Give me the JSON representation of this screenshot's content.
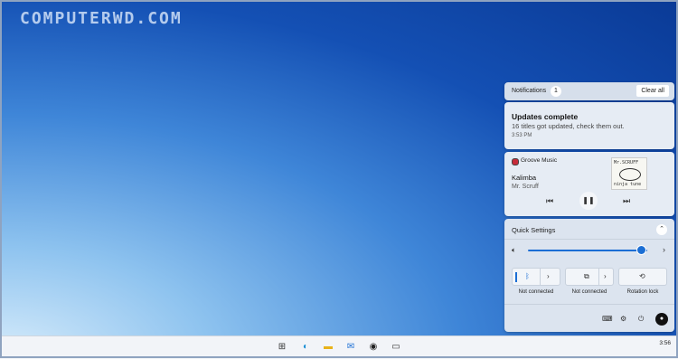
{
  "watermark": "COMPUTERWD.COM",
  "notifications": {
    "header_title": "Notifications",
    "count": "1",
    "clear_all": "Clear all",
    "items": [
      {
        "title": "Updates complete",
        "body": "16 titles got updated, check them out.",
        "time": "3:53 PM"
      }
    ]
  },
  "media": {
    "app": "Groove Music",
    "song": "Kalimba",
    "artist": "Mr. Scruff",
    "art_line1": "Mr.SCRUFF",
    "art_line2": "ninja tune",
    "prev_icon": "previous-track-icon",
    "pause_icon": "pause-icon",
    "next_icon": "next-track-icon"
  },
  "quick_settings": {
    "title": "Quick Settings",
    "volume_level": 0.95,
    "tiles": [
      {
        "label": "Not connected",
        "icon": "bluetooth-icon"
      },
      {
        "label": "Not connected",
        "icon": "cast-icon"
      },
      {
        "label": "Rotation lock",
        "icon": "rotation-lock-icon"
      }
    ],
    "footer_icons": [
      "keyboard-icon",
      "settings-icon",
      "power-icon",
      "account-icon"
    ]
  },
  "taskbar": {
    "time": "3:56",
    "icons": [
      "windows-start-icon",
      "edge-icon",
      "file-explorer-icon",
      "mail-icon",
      "groove-music-icon",
      "task-view-icon"
    ]
  },
  "colors": {
    "accent": "#1b6ed4",
    "record_red": "#c72b3a"
  }
}
